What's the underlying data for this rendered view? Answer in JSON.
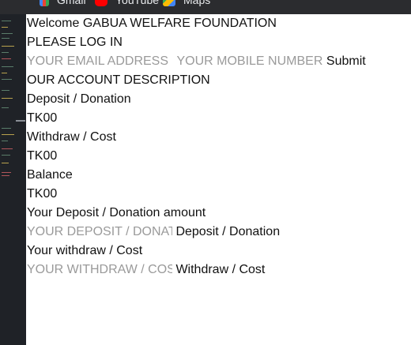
{
  "bookmarks": [
    {
      "label": "Gmail",
      "icon": "gmail-icon"
    },
    {
      "label": "YouTube",
      "icon": "youtube-icon"
    },
    {
      "label": "Maps",
      "icon": "maps-icon"
    }
  ],
  "welcome_text": "Welcome GABUA WELFARE FOUNDATION",
  "login": {
    "heading": "PLEASE LOG IN",
    "email_placeholder": "YOUR EMAIL ADDRESS",
    "mobile_placeholder": "YOUR MOBILE NUMBER",
    "submit_label": "Submit"
  },
  "account": {
    "heading": "OUR ACCOUNT DESCRIPTION",
    "deposit_label": "Deposit / Donation",
    "deposit_value": "TK00",
    "withdraw_label": "Withdraw / Cost",
    "withdraw_value": "TK00",
    "balance_label": "Balance",
    "balance_value": "TK00"
  },
  "deposit_form": {
    "heading": "Your Deposit / Donation amount",
    "placeholder": "YOUR DEPOSIT / DONATION",
    "button_label": "Deposit / Donation"
  },
  "withdraw_form": {
    "heading": "Your withdraw / Cost",
    "placeholder": "YOUR WITHDRAW / COST",
    "button_label": "Withdraw / Cost"
  }
}
